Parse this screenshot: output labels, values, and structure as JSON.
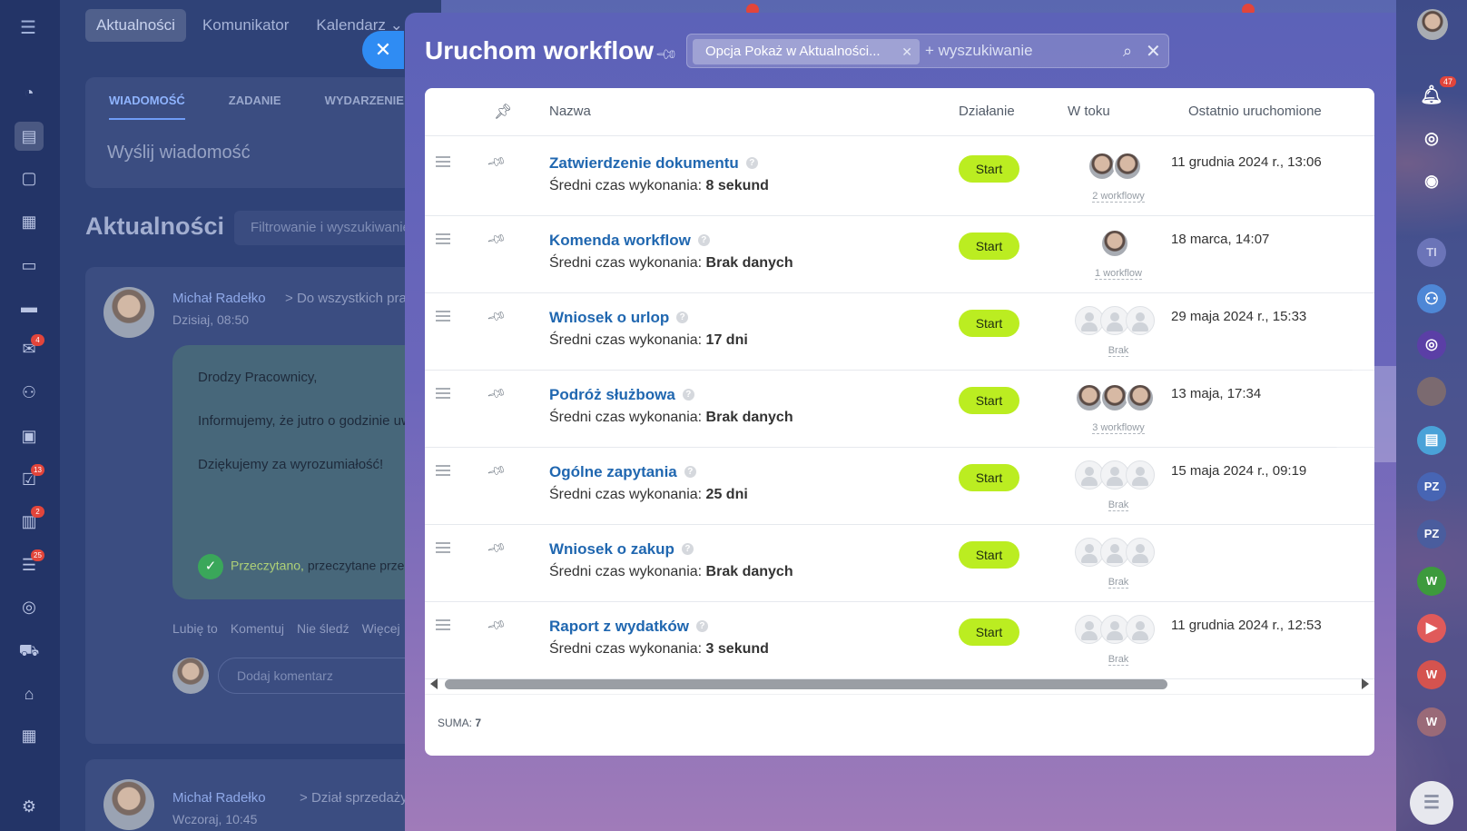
{
  "app": {
    "topnav": [
      "Aktualności",
      "Komunikator",
      "Kalendarz ⌄"
    ],
    "compose": {
      "tabs": [
        "WIADOMOŚĆ",
        "ZADANIE",
        "WYDARZENIE"
      ],
      "placeholder": "Wyślij wiadomość"
    },
    "feed": {
      "title": "Aktualności",
      "filter_placeholder": "Filtrowanie i wyszukiwanie"
    },
    "post": {
      "author": "Michał Radełko",
      "destination": "Do wszystkich pracowników",
      "time": "Dzisiaj, 08:50",
      "body": [
        "Drodzy Pracownicy,",
        "Informujemy, że jutro o godzinie uwzględnienie tego w swoich planach.",
        "Dziękujemy za wyrozumiałość!"
      ],
      "read_label": "Przeczytano,",
      "read_rest": "przeczytane przez",
      "actions": [
        "Lubię to",
        "Komentuj",
        "Nie śledź",
        "Więcej"
      ],
      "comment_placeholder": "Dodaj komentarz"
    },
    "post2": {
      "author": "Michał Radełko",
      "destination": "Dział sprzedaży",
      "time": "Wczoraj, 10:45"
    },
    "left_badges": [
      "4",
      "13",
      "2",
      "25"
    ],
    "right_rail": {
      "notifications_badge": "47",
      "items": [
        "TI",
        "PZ",
        "PZ",
        "W",
        "W",
        "W"
      ]
    }
  },
  "panel": {
    "title": "Uruchom workflow",
    "filter_chip": "Opcja Pokaż w Aktualności...",
    "search_placeholder": "+ wyszukiwanie",
    "columns": {
      "name": "Nazwa",
      "action": "Działanie",
      "in_progress": "W toku",
      "last_run": "Ostatnio uruchomione"
    },
    "avg_prefix": "Średni czas wykonania:",
    "start_label": "Start",
    "rows": [
      {
        "name": "Zatwierdzenie dokumentu",
        "avg": "8 sekund",
        "running": "2 workflowy",
        "avatars": 2,
        "last_run": "11 grudnia 2024 r., 13:06"
      },
      {
        "name": "Komenda workflow",
        "avg": "Brak danych",
        "running": "1 workflow",
        "avatars": 1,
        "last_run": "18 marca, 14:07"
      },
      {
        "name": "Wniosek o urlop",
        "avg": "17 dni",
        "running": "Brak",
        "avatars": 0,
        "last_run": "29 maja 2024 r., 15:33"
      },
      {
        "name": "Podróż służbowa",
        "avg": "Brak danych",
        "running": "3 workflowy",
        "avatars": 3,
        "last_run": "13 maja, 17:34"
      },
      {
        "name": "Ogólne zapytania",
        "avg": "25 dni",
        "running": "Brak",
        "avatars": 0,
        "last_run": "15 maja 2024 r., 09:19"
      },
      {
        "name": "Wniosek o zakup",
        "avg": "Brak danych",
        "running": "Brak",
        "avatars": 0,
        "last_run": ""
      },
      {
        "name": "Raport z wydatków",
        "avg": "3 sekund",
        "running": "Brak",
        "avatars": 0,
        "last_run": "11 grudnia 2024 r., 12:53"
      }
    ],
    "footer_label": "SUMA:",
    "footer_total": "7"
  }
}
